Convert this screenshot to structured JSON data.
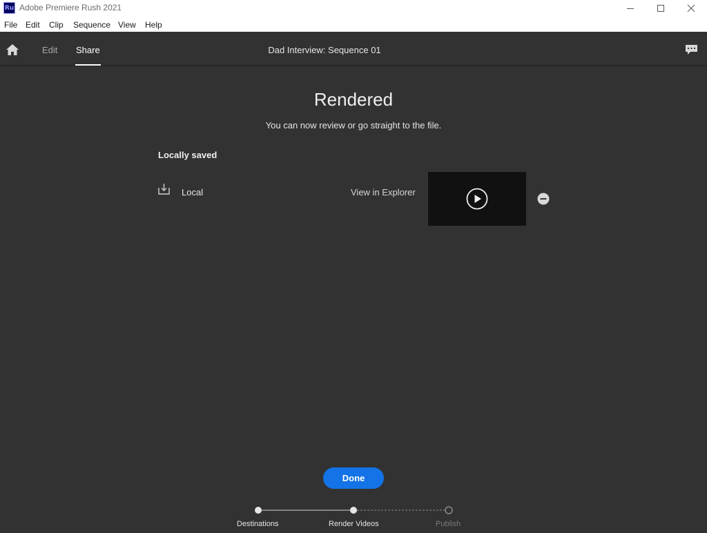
{
  "window": {
    "title": "Adobe Premiere Rush 2021",
    "app_icon_text": "Ru"
  },
  "menu": [
    "File",
    "Edit",
    "Clip",
    "Sequence",
    "View",
    "Help"
  ],
  "header": {
    "tabs": [
      {
        "label": "Edit",
        "active": false
      },
      {
        "label": "Share",
        "active": true
      }
    ],
    "sequence_title": "Dad Interview: Sequence 01"
  },
  "main": {
    "heading": "Rendered",
    "subheading": "You can now review or go straight to the file.",
    "section_label": "Locally saved",
    "destination": {
      "label": "Local",
      "link": "View in Explorer"
    }
  },
  "footer": {
    "done_label": "Done",
    "steps": [
      {
        "label": "Destinations",
        "state": "complete"
      },
      {
        "label": "Render Videos",
        "state": "complete"
      },
      {
        "label": "Publish",
        "state": "pending"
      }
    ]
  },
  "colors": {
    "accent": "#1473e6",
    "background": "#323232",
    "brand_icon": "#00005b"
  },
  "icons": [
    "home-icon",
    "feedback-icon",
    "download-icon",
    "play-icon",
    "remove-icon",
    "minimize-icon",
    "maximize-icon",
    "close-icon"
  ]
}
